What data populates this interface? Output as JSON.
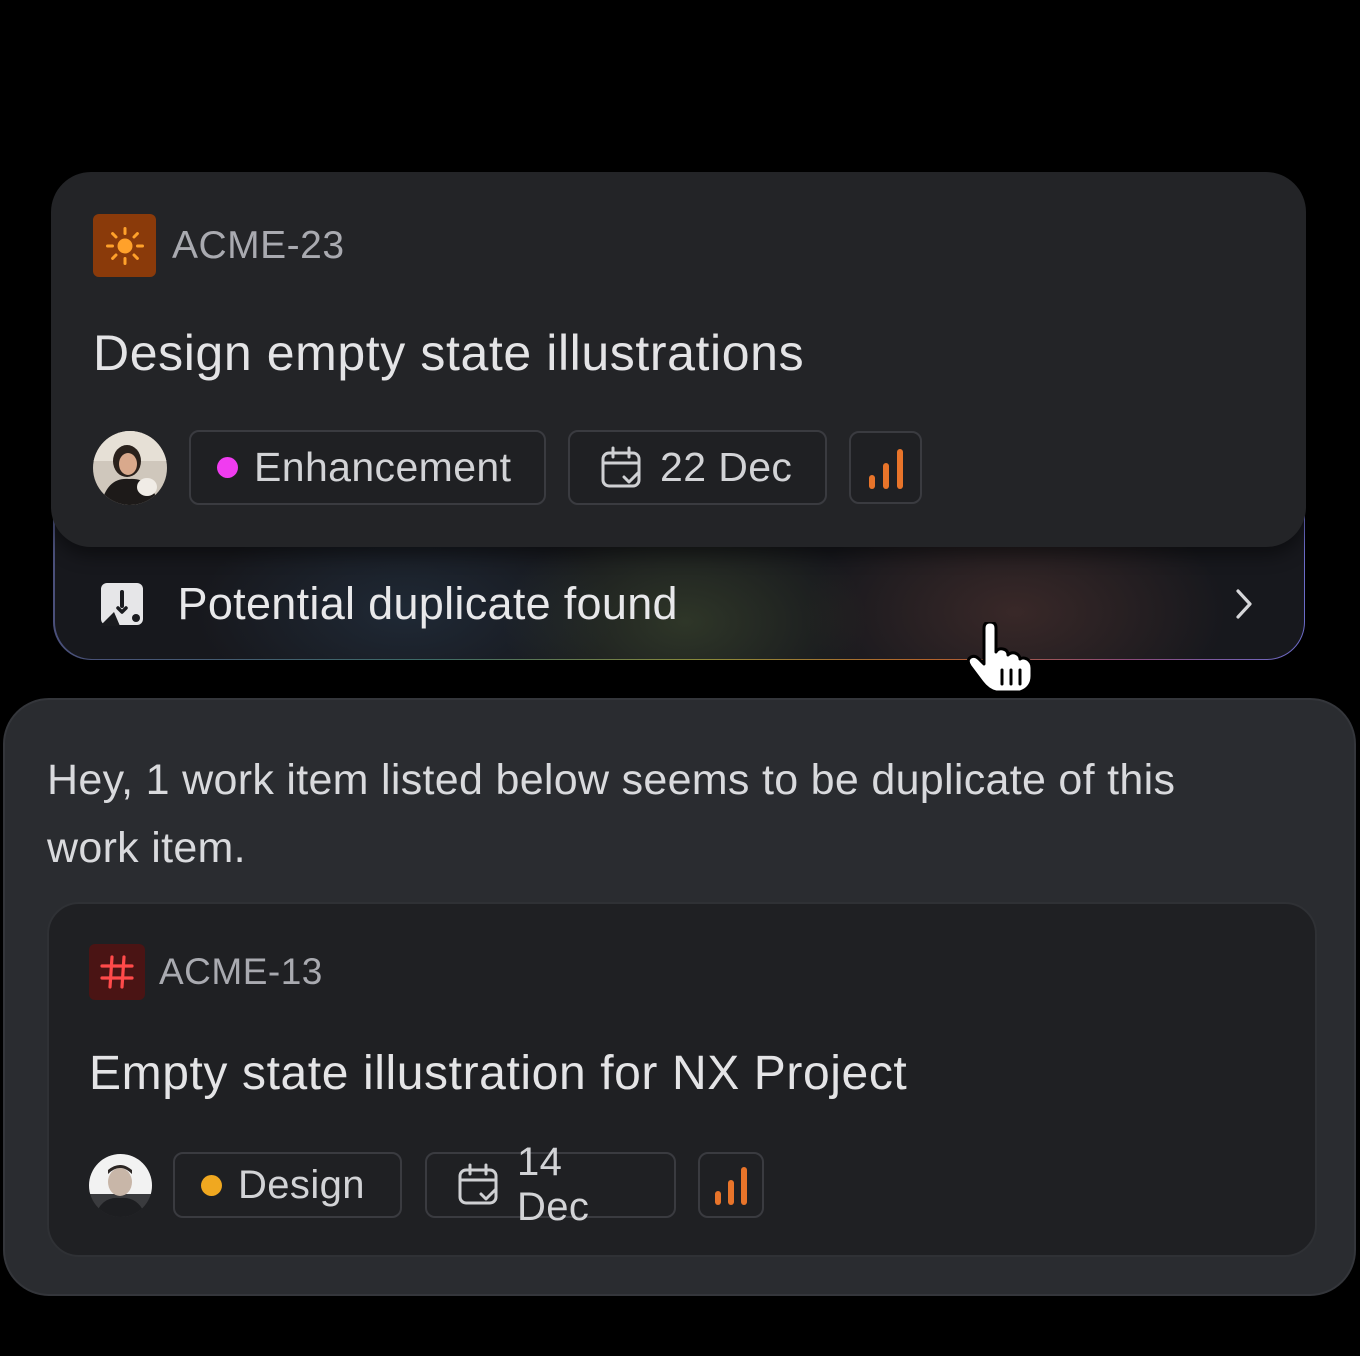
{
  "current_item": {
    "id": "ACME-23",
    "icon": "sun-icon",
    "icon_bg": "#8a3a0a",
    "title": "Design empty state illustrations",
    "label": {
      "text": "Enhancement",
      "color": "#f03cf0"
    },
    "date": "22 Dec",
    "priority_icon": "signal-bars-icon",
    "priority_color": "#e8742a"
  },
  "duplicate_banner": {
    "text": "Potential duplicate found",
    "icon": "duplicate-alert-icon",
    "action_icon": "chevron-right-icon"
  },
  "duplicate_panel": {
    "message": "Hey, 1 work item listed below seems to be duplicate of this work item.",
    "item": {
      "id": "ACME-13",
      "icon": "hash-icon",
      "icon_bg": "#4a1414",
      "icon_color": "#ff4a4a",
      "title": "Empty state illustration for NX Project",
      "label": {
        "text": "Design",
        "color": "#f0a820"
      },
      "date": "14 Dec",
      "priority_icon": "signal-bars-icon",
      "priority_color": "#e8742a"
    }
  },
  "cursor": "hand-pointer-icon"
}
